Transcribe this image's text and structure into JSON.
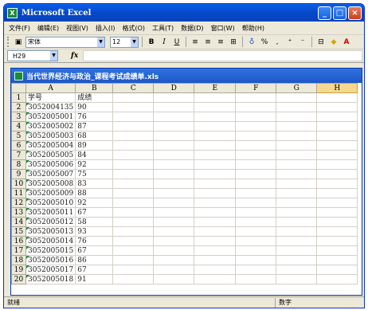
{
  "window": {
    "title": "Microsoft Excel"
  },
  "menu": [
    "文件(F)",
    "编辑(E)",
    "视图(V)",
    "插入(I)",
    "格式(O)",
    "工具(T)",
    "数据(D)",
    "窗口(W)",
    "帮助(H)"
  ],
  "toolbar": {
    "font": "宋体",
    "font_size": "12",
    "bold": "B",
    "italic": "I",
    "underline": "U",
    "percent": "%",
    "comma": ","
  },
  "formula_bar": {
    "name_box": "H29",
    "fx": "fx"
  },
  "workbook": {
    "title": "当代世界经济与政治_课程考试成绩单.xls",
    "columns": [
      "A",
      "B",
      "C",
      "D",
      "E",
      "F",
      "G",
      "H"
    ],
    "selected_column": "H",
    "rows": [
      {
        "n": "1",
        "a": "学号",
        "b": "成绩"
      },
      {
        "n": "2",
        "a": "3052004135",
        "b": "90"
      },
      {
        "n": "3",
        "a": "3052005001",
        "b": "76"
      },
      {
        "n": "4",
        "a": "3052005002",
        "b": "87"
      },
      {
        "n": "5",
        "a": "3052005003",
        "b": "68"
      },
      {
        "n": "6",
        "a": "3052005004",
        "b": "89"
      },
      {
        "n": "7",
        "a": "3052005005",
        "b": "84"
      },
      {
        "n": "8",
        "a": "3052005006",
        "b": "92"
      },
      {
        "n": "9",
        "a": "3052005007",
        "b": "75"
      },
      {
        "n": "10",
        "a": "3052005008",
        "b": "83"
      },
      {
        "n": "11",
        "a": "3052005009",
        "b": "88"
      },
      {
        "n": "12",
        "a": "3052005010",
        "b": "92"
      },
      {
        "n": "13",
        "a": "3052005011",
        "b": "67"
      },
      {
        "n": "14",
        "a": "3052005012",
        "b": "58"
      },
      {
        "n": "15",
        "a": "3052005013",
        "b": "93"
      },
      {
        "n": "16",
        "a": "3052005014",
        "b": "76"
      },
      {
        "n": "17",
        "a": "3052005015",
        "b": "67"
      },
      {
        "n": "18",
        "a": "3052005016",
        "b": "86"
      },
      {
        "n": "19",
        "a": "3052005017",
        "b": "67"
      },
      {
        "n": "20",
        "a": "3052005018",
        "b": "91"
      }
    ]
  },
  "status": {
    "left": "就绪",
    "mode": "数字"
  }
}
